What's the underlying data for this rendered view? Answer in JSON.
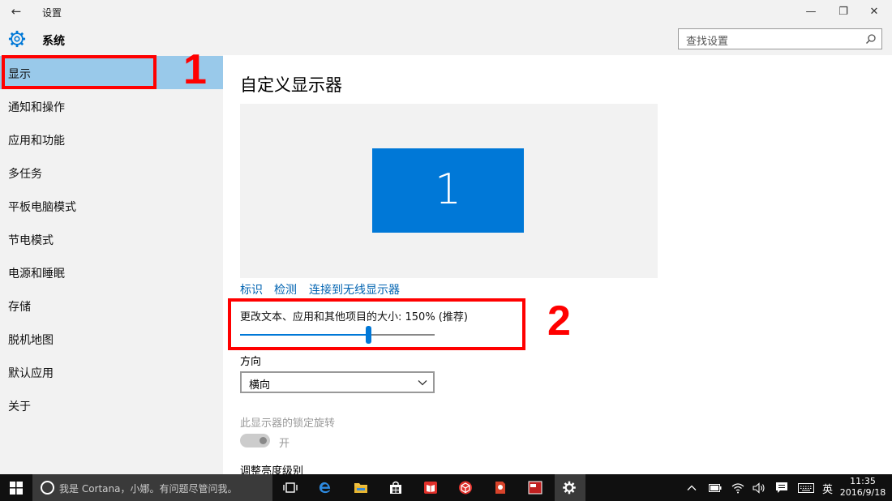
{
  "window": {
    "title": "设置",
    "back_glyph": "←",
    "minimize_glyph": "—",
    "maximize_glyph": "❐",
    "close_glyph": "✕"
  },
  "header": {
    "icon": "gear-icon",
    "title": "系统",
    "search_placeholder": "查找设置",
    "search_icon": "search-icon"
  },
  "sidebar": {
    "items": [
      {
        "label": "显示",
        "selected": true
      },
      {
        "label": "通知和操作"
      },
      {
        "label": "应用和功能"
      },
      {
        "label": "多任务"
      },
      {
        "label": "平板电脑模式"
      },
      {
        "label": "节电模式"
      },
      {
        "label": "电源和睡眠"
      },
      {
        "label": "存储"
      },
      {
        "label": "脱机地图"
      },
      {
        "label": "默认应用"
      },
      {
        "label": "关于"
      }
    ]
  },
  "annotations": {
    "marker_1": "1",
    "marker_2": "2",
    "color": "#ff0000"
  },
  "main": {
    "title": "自定义显示器",
    "monitor_label": "1",
    "links": {
      "identify": "标识",
      "detect": "检测",
      "wireless": "连接到无线显示器"
    },
    "scale": {
      "label": "更改文本、应用和其他项目的大小: 150% (推荐)",
      "level_fraction": 0.66
    },
    "orientation": {
      "label": "方向",
      "value": "横向"
    },
    "rotation_lock": {
      "label": "此显示器的锁定旋转",
      "state": "开",
      "enabled": false
    },
    "brightness": {
      "label": "调整亮度级别"
    },
    "accent": "#0078d7"
  },
  "taskbar": {
    "cortana_placeholder": "我是 Cortana，小娜。有问题尽管问我。",
    "ime": "英",
    "time": "11:35",
    "date": "2016/9/18"
  }
}
